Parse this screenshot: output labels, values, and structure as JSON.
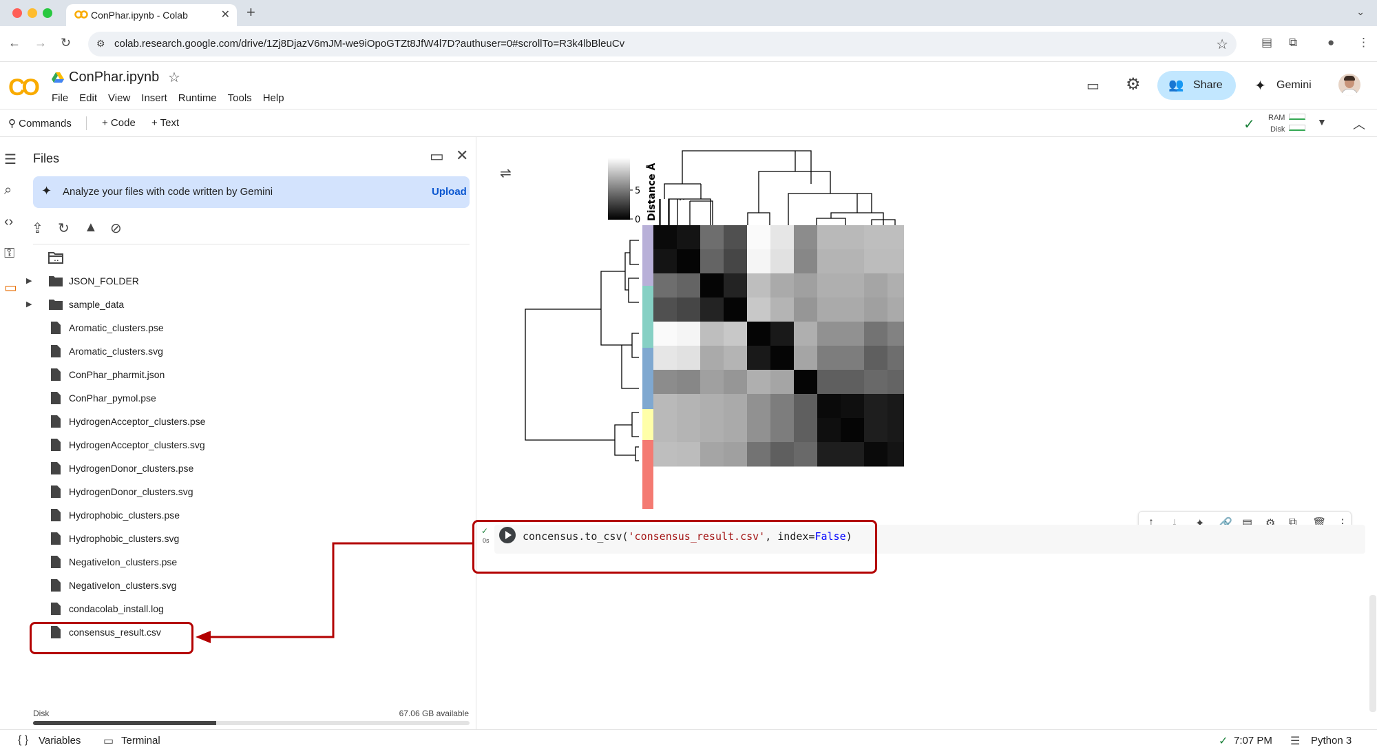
{
  "browser": {
    "tab_title": "ConPhar.ipynb - Colab",
    "tab_close_glyph": "✕",
    "new_tab_glyph": "+",
    "url": "colab.research.google.com/drive/1Zj8DjazV6mJM-we9iOpoGTZt8JfW4l7D?authuser=0#scrollTo=R3k4lbBleuCv",
    "traffic_colors": [
      "#ff5f57",
      "#febc2e",
      "#28c840"
    ]
  },
  "header": {
    "logo_text": "CO",
    "notebook_title": "ConPhar.ipynb",
    "menu": [
      "File",
      "Edit",
      "View",
      "Insert",
      "Runtime",
      "Tools",
      "Help"
    ],
    "share_label": "Share",
    "gemini_label": "Gemini"
  },
  "toolbar": {
    "commands_label": "Commands",
    "code_label": "+ Code",
    "text_label": "+ Text",
    "ram_label": "RAM",
    "disk_label": "Disk"
  },
  "files_panel": {
    "title": "Files",
    "banner_text": "Analyze your files with code written by Gemini",
    "upload_label": "Upload",
    "items": [
      {
        "name": "..",
        "kind": "parent"
      },
      {
        "name": "JSON_FOLDER",
        "kind": "folder"
      },
      {
        "name": "sample_data",
        "kind": "folder"
      },
      {
        "name": "Aromatic_clusters.pse",
        "kind": "file"
      },
      {
        "name": "Aromatic_clusters.svg",
        "kind": "file"
      },
      {
        "name": "ConPhar_pharmit.json",
        "kind": "file"
      },
      {
        "name": "ConPhar_pymol.pse",
        "kind": "file"
      },
      {
        "name": "HydrogenAcceptor_clusters.pse",
        "kind": "file"
      },
      {
        "name": "HydrogenAcceptor_clusters.svg",
        "kind": "file"
      },
      {
        "name": "HydrogenDonor_clusters.pse",
        "kind": "file"
      },
      {
        "name": "HydrogenDonor_clusters.svg",
        "kind": "file"
      },
      {
        "name": "Hydrophobic_clusters.pse",
        "kind": "file"
      },
      {
        "name": "Hydrophobic_clusters.svg",
        "kind": "file"
      },
      {
        "name": "NegativeIon_clusters.pse",
        "kind": "file"
      },
      {
        "name": "NegativeIon_clusters.svg",
        "kind": "file"
      },
      {
        "name": "condacolab_install.log",
        "kind": "file"
      },
      {
        "name": "consensus_result.csv",
        "kind": "file"
      }
    ],
    "disk_caption": "Disk",
    "disk_available": "67.06 GB available",
    "disk_used_fraction": 0.42
  },
  "output_figure": {
    "colorbar_label": "Distance Å",
    "colorbar_ticks": [
      "5",
      "0"
    ],
    "row_group_colors": [
      "#b8b0d8",
      "#86d0c4",
      "#7fa8d0",
      "#ffffa8",
      "#f47a72"
    ],
    "heatmap_gray": [
      [
        10,
        20,
        110,
        80,
        250,
        230,
        140,
        185,
        185,
        190,
        190
      ],
      [
        20,
        5,
        100,
        70,
        245,
        225,
        135,
        180,
        180,
        188,
        188
      ],
      [
        110,
        100,
        5,
        35,
        190,
        170,
        160,
        175,
        175,
        165,
        175
      ],
      [
        80,
        70,
        35,
        5,
        200,
        180,
        150,
        170,
        170,
        160,
        170
      ],
      [
        250,
        245,
        190,
        200,
        5,
        25,
        175,
        145,
        145,
        115,
        130
      ],
      [
        230,
        225,
        170,
        180,
        25,
        5,
        165,
        125,
        125,
        95,
        110
      ],
      [
        140,
        135,
        160,
        150,
        175,
        165,
        5,
        95,
        95,
        105,
        100
      ],
      [
        185,
        180,
        175,
        170,
        145,
        125,
        95,
        10,
        15,
        30,
        25
      ],
      [
        185,
        180,
        175,
        170,
        145,
        125,
        95,
        15,
        5,
        30,
        25
      ],
      [
        190,
        188,
        165,
        160,
        115,
        95,
        105,
        30,
        30,
        10,
        20
      ]
    ]
  },
  "cell": {
    "status_check": "✓",
    "status_time": "0s",
    "code_prefix": "concensus.to_csv(",
    "code_string": "'consensus_result.csv'",
    "code_middle": ", index=",
    "code_keyword": "False",
    "code_suffix": ")"
  },
  "statusbar": {
    "variables_label": "Variables",
    "terminal_label": "Terminal",
    "time": "7:07 PM",
    "runtime": "Python 3"
  },
  "annotation": {
    "color": "#b30000"
  }
}
